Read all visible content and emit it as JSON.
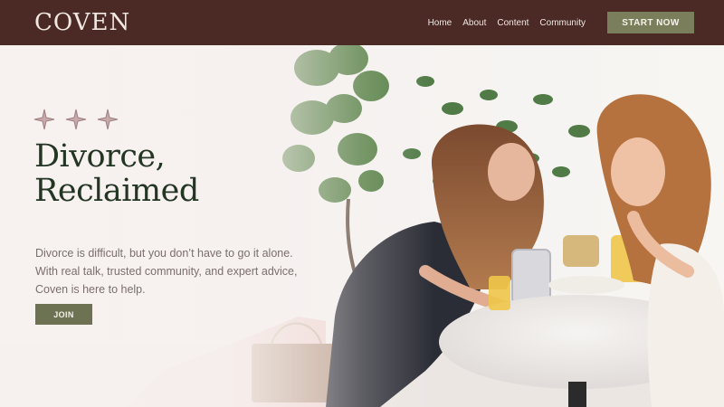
{
  "header": {
    "logo": "COVEN",
    "nav": [
      "Home",
      "About",
      "Content",
      "Community"
    ],
    "cta_label": "START NOW"
  },
  "hero": {
    "headline_line1": "Divorce,",
    "headline_line2": "Reclaimed",
    "description": "Divorce is difficult, but you don’t have to go it alone. With real talk, trusted community, and expert advice, Coven is here to help.",
    "join_label": "JOIN"
  },
  "colors": {
    "header_bg": "#4b2a26",
    "cta_bg": "#7a7e5a",
    "headline": "#233523",
    "body_text": "#7a6f6d",
    "star": "#a98a8b"
  },
  "icons": [
    "sparkle-icon",
    "sparkle-icon",
    "sparkle-icon"
  ]
}
